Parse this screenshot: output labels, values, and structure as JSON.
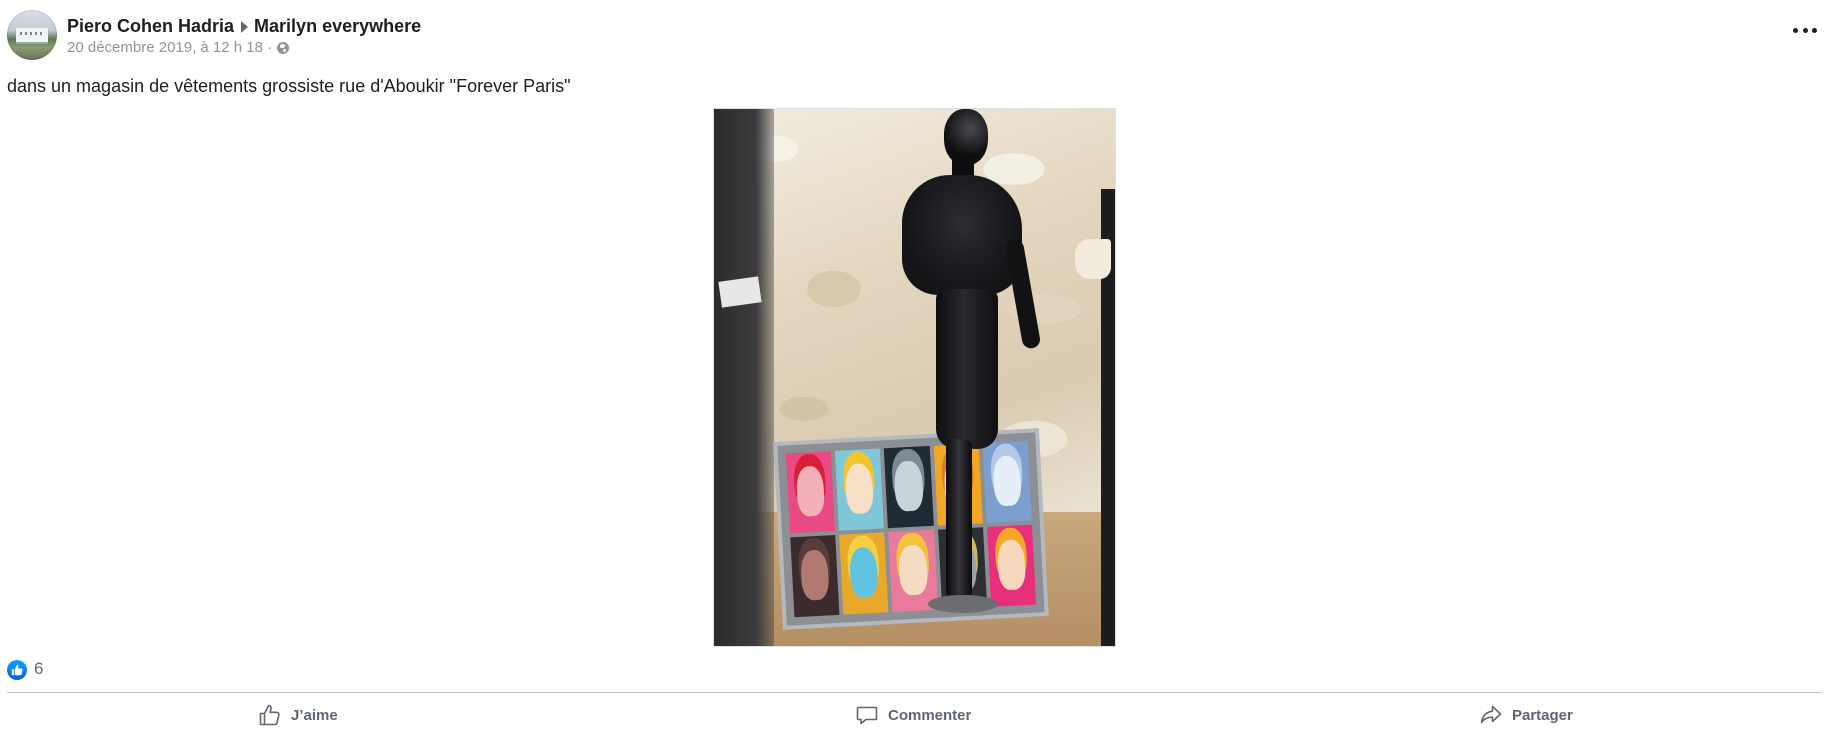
{
  "post": {
    "author": "Piero Cohen Hadria",
    "group": "Marilyn everywhere",
    "timestamp": "20 décembre 2019, à 12 h 18 ·",
    "privacy_icon": "globe-icon",
    "more_icon": "more-options-icon",
    "text": "dans un magasin de vêtements grossiste rue d'Aboukir \"Forever Paris\"",
    "photo_icon": "post-photo",
    "reactions": {
      "icon": "like-reaction-icon",
      "count": "6"
    }
  },
  "actions": {
    "like_label": "J’aime",
    "comment_label": "Commenter",
    "share_label": "Partager"
  },
  "colors": {
    "accent": "#1877f2",
    "secondary_text": "#606770",
    "meta_text": "#90949c",
    "divider": "#c4c7cc"
  }
}
